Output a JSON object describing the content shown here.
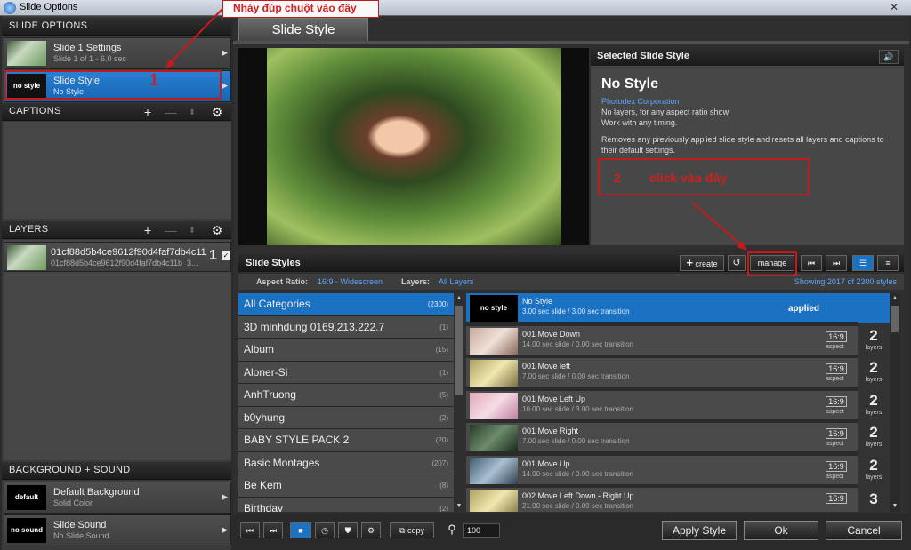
{
  "window": {
    "title": "Slide Options"
  },
  "annotations": {
    "top": "Nháy đúp chuột vào đây",
    "one": "1",
    "two": "2",
    "click": "click vào đây"
  },
  "left": {
    "slide_options": "SLIDE OPTIONS",
    "slide_settings": {
      "title": "Slide 1 Settings",
      "sub": "Slide 1 of 1 - 6.0 sec"
    },
    "slide_style": {
      "thumb": "no style",
      "title": "Slide Style",
      "sub": "No Style"
    },
    "captions": "CAPTIONS",
    "layers": "LAYERS",
    "layer": {
      "title": "01cf88d5b4ce9612f90d4faf7db4c11...",
      "sub": "01cf88d5b4ce9612f90d4faf7db4c11b_3...",
      "num": "1"
    },
    "bg_sound": "BACKGROUND + SOUND",
    "background": {
      "thumb": "default",
      "title": "Default Background",
      "sub": "Solid Color"
    },
    "sound": {
      "thumb": "no sound",
      "title": "Slide Sound",
      "sub": "No Slide Sound"
    }
  },
  "tab": "Slide Style",
  "selected": {
    "header": "Selected Slide Style",
    "name": "No Style",
    "company": "Photodex Corporation",
    "line1": "No layers, for any aspect ratio show",
    "line2": "Work with any timing.",
    "desc": "Removes any previously applied slide style and resets all layers and captions to their default settings."
  },
  "styles": {
    "header": "Slide Styles",
    "create": "create",
    "manage": "manage",
    "aspect_label": "Aspect Ratio:",
    "aspect_value": "16:9 - Widescreen",
    "layers_label": "Layers:",
    "layers_value": "All Layers",
    "showing": "Showing 2017 of 2300 styles"
  },
  "categories": [
    {
      "name": "All Categories",
      "count": "(2300)"
    },
    {
      "name": "3D minhdung 0169.213.222.7",
      "count": "(1)"
    },
    {
      "name": "Album",
      "count": "(15)"
    },
    {
      "name": "Aloner-Si",
      "count": "(1)"
    },
    {
      "name": "AnhTruong",
      "count": "(5)"
    },
    {
      "name": "b0yhung",
      "count": "(2)"
    },
    {
      "name": "BABY STYLE PACK 2",
      "count": "(20)"
    },
    {
      "name": "Basic Montages",
      "count": "(207)"
    },
    {
      "name": "Be Kem",
      "count": "(8)"
    },
    {
      "name": "Birthday",
      "count": "(2)"
    }
  ],
  "list": [
    {
      "thumb": "no style",
      "name": "No Style",
      "desc": "3.00 sec slide / 3.00 sec transition",
      "status": "applied"
    },
    {
      "name": "001 Move Down",
      "desc": "14.00 sec slide / 0.00 sec transition",
      "aspect": "16:9",
      "aspect_label": "aspect",
      "layers": "2",
      "layers_label": "layers"
    },
    {
      "name": "001 Move left",
      "desc": "7.00 sec slide / 0.00 sec transition",
      "aspect": "16:9",
      "aspect_label": "aspect",
      "layers": "2",
      "layers_label": "layers"
    },
    {
      "name": "001 Move Left Up",
      "desc": "10.00 sec slide / 3.00 sec transition",
      "aspect": "16:9",
      "aspect_label": "aspect",
      "layers": "2",
      "layers_label": "layers"
    },
    {
      "name": "001 Move Right",
      "desc": "7.00 sec slide / 0.00 sec transition",
      "aspect": "16:9",
      "aspect_label": "aspect",
      "layers": "2",
      "layers_label": "layers"
    },
    {
      "name": "001 Move Up",
      "desc": "14.00 sec slide / 0.00 sec transition",
      "aspect": "16:9",
      "aspect_label": "aspect",
      "layers": "2",
      "layers_label": "layers"
    },
    {
      "name": "002 Move Left Down - Right Up",
      "desc": "21.00 sec slide / 0.00 sec transition",
      "aspect": "16:9",
      "layers": "3"
    }
  ],
  "bottom": {
    "copy": "copy",
    "zoom": "100",
    "apply": "Apply Style",
    "ok": "Ok",
    "cancel": "Cancel"
  }
}
